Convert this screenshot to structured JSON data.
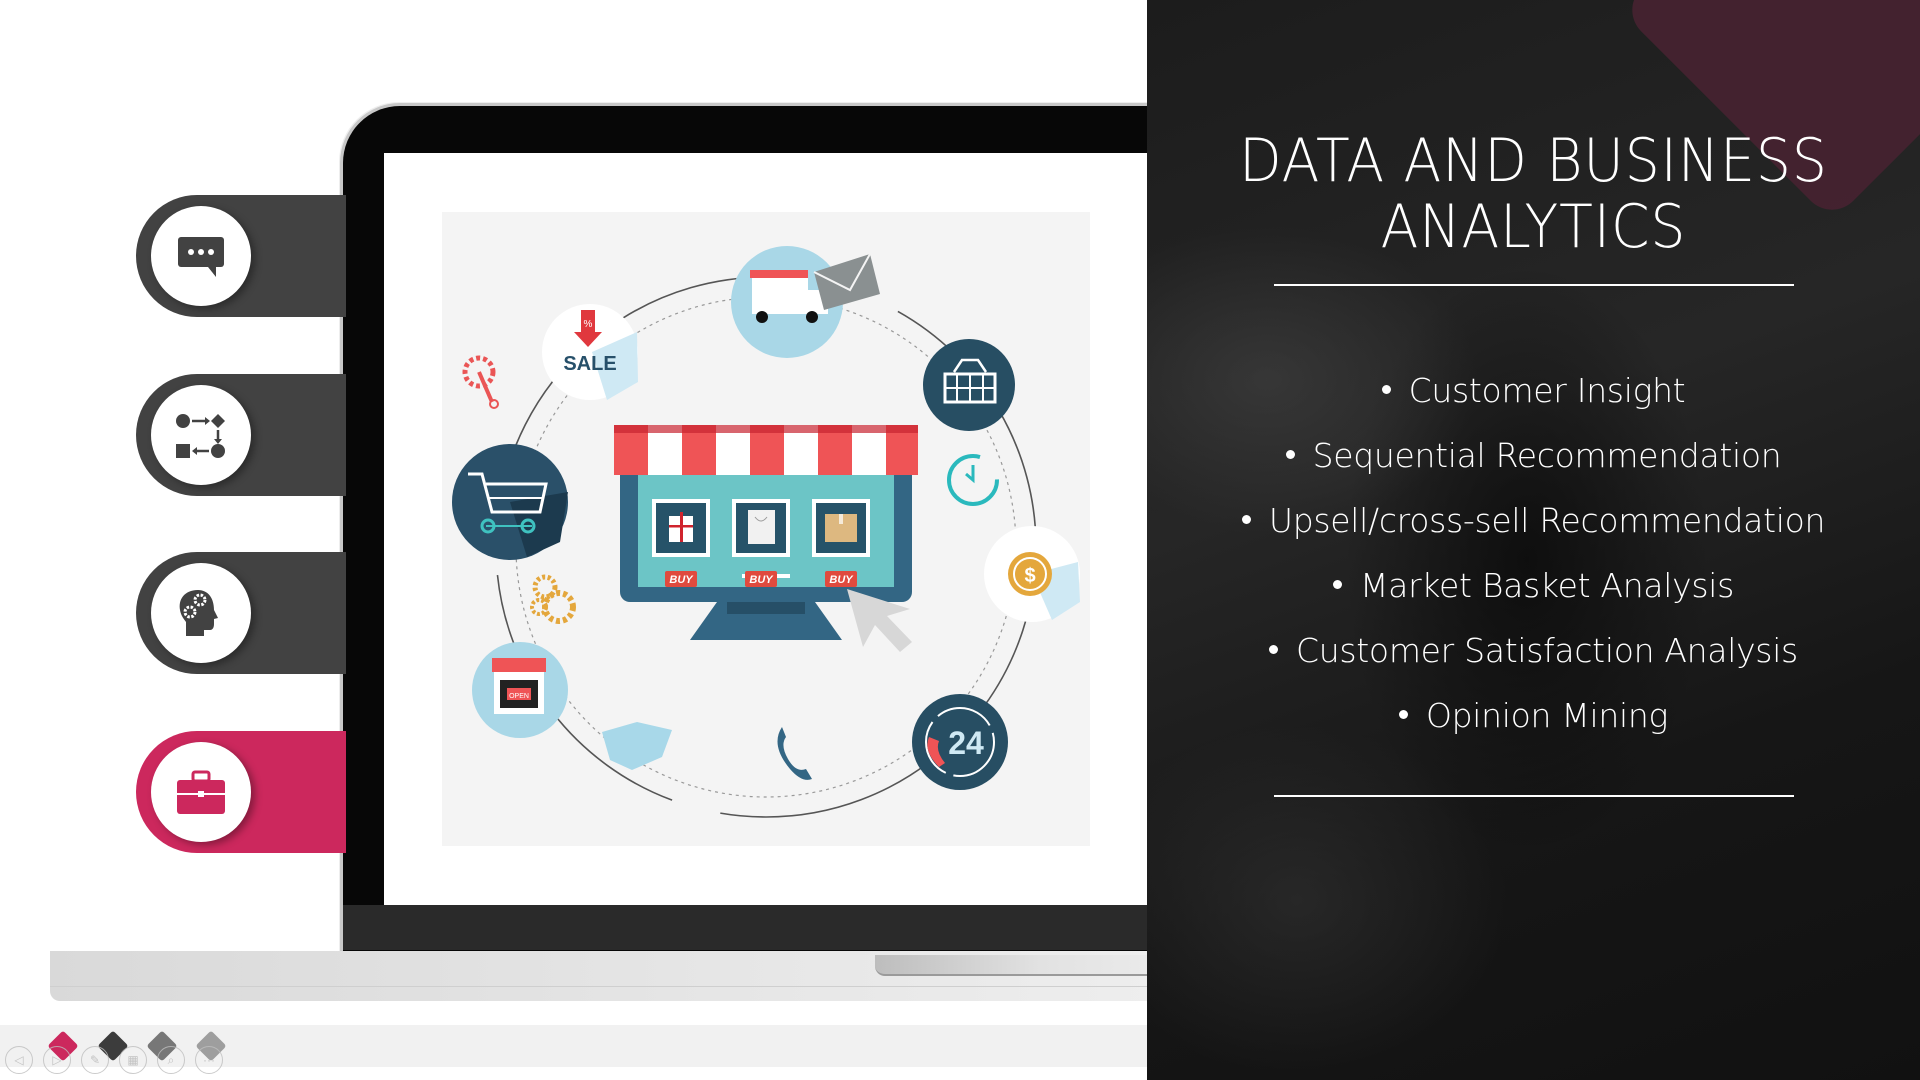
{
  "slide": {
    "title_line1": "DATA AND BUSINESS",
    "title_line2": "ANALYTICS",
    "bullets": [
      "Customer Insight",
      "Sequential Recommendation",
      "Upsell/cross-sell Recommendation",
      "Market Basket Analysis",
      "Customer Satisfaction Analysis",
      "Opinion Mining"
    ]
  },
  "tabs": [
    {
      "icon": "chat-bubble-icon",
      "active": false
    },
    {
      "icon": "process-flow-icon",
      "active": false
    },
    {
      "icon": "head-gears-icon",
      "active": false
    },
    {
      "icon": "briefcase-icon",
      "active": true
    }
  ],
  "illustration": {
    "sale_label": "SALE",
    "percent_label": "%",
    "buy_labels": [
      "BUY",
      "BUY",
      "BUY"
    ],
    "open_sign": "OPEN",
    "support_hours": "24",
    "currency_symbol": "$"
  },
  "slide_indicators": [
    {
      "color": "#cc285d",
      "state": "current"
    },
    {
      "color": "#3c3c3c",
      "state": "other"
    },
    {
      "color": "#777777",
      "state": "other"
    },
    {
      "color": "#9e9e9e",
      "state": "other"
    }
  ],
  "controls": [
    {
      "name": "previous-slide",
      "glyph": "◁"
    },
    {
      "name": "next-slide",
      "glyph": "▷"
    },
    {
      "name": "pen-tool",
      "glyph": "✎"
    },
    {
      "name": "slide-sorter",
      "glyph": "▦"
    },
    {
      "name": "zoom",
      "glyph": "⌕"
    },
    {
      "name": "more-options",
      "glyph": "···"
    }
  ],
  "colors": {
    "accent": "#cc285d",
    "tab_dark": "#424242",
    "panel_dark": "#1f1f1f",
    "panel_accent": "#462330"
  }
}
